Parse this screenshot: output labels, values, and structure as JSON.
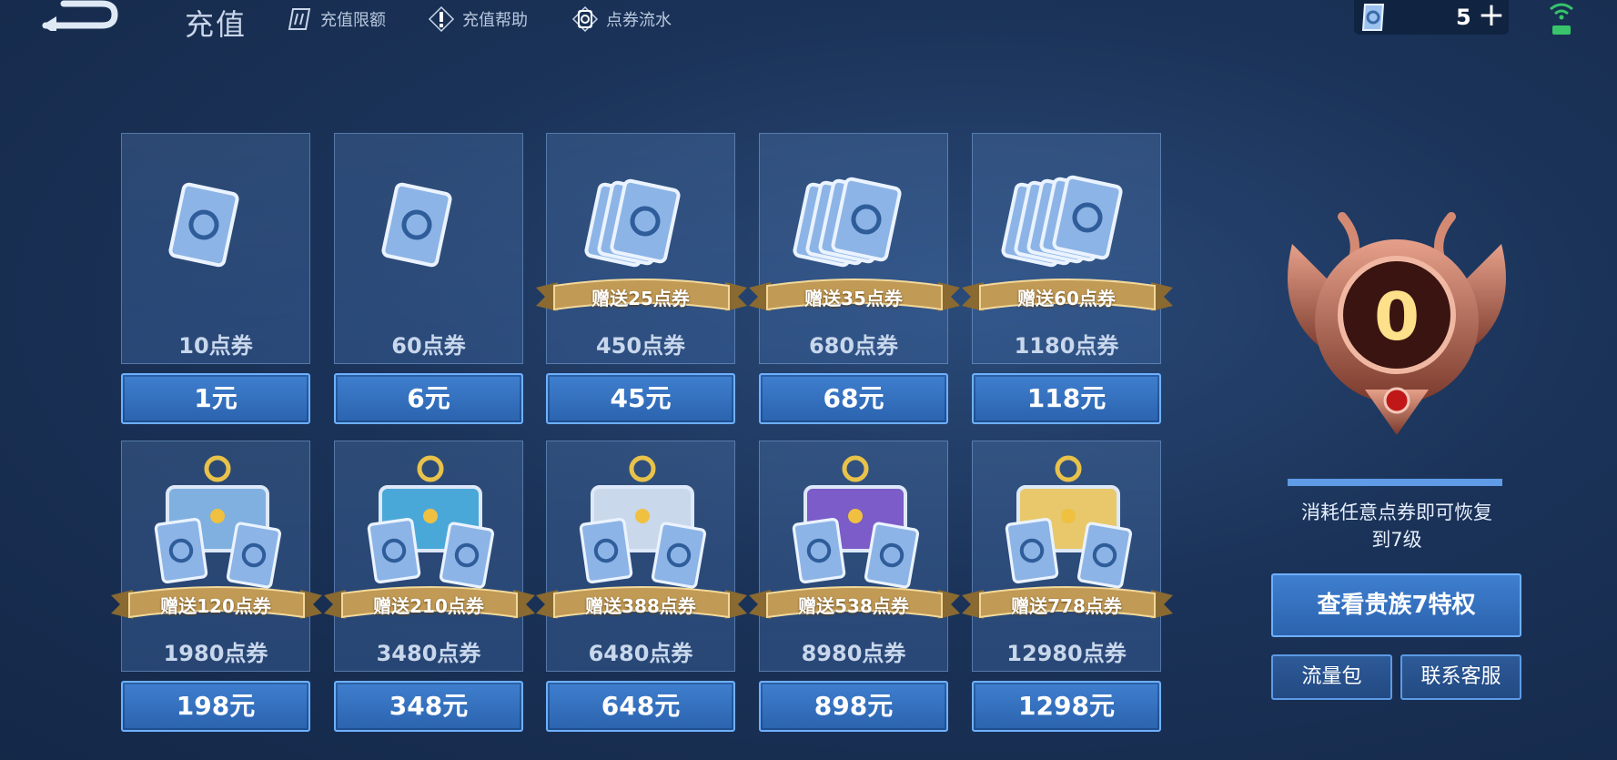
{
  "header": {
    "title": "充值",
    "links": [
      {
        "label": "充值限额",
        "icon": "cards-icon"
      },
      {
        "label": "充值帮助",
        "icon": "exclamation-icon"
      },
      {
        "label": "点券流水",
        "icon": "coupon-flow-icon"
      }
    ],
    "currency": {
      "value": "5",
      "icon": "coupon-icon",
      "add_icon": "plus-icon"
    }
  },
  "packages": [
    {
      "amount": "10点券",
      "price": "1元",
      "bonus": ""
    },
    {
      "amount": "60点券",
      "price": "6元",
      "bonus": ""
    },
    {
      "amount": "450点券",
      "price": "45元",
      "bonus": "赠送25点券"
    },
    {
      "amount": "680点券",
      "price": "68元",
      "bonus": "赠送35点券"
    },
    {
      "amount": "1180点券",
      "price": "118元",
      "bonus": "赠送60点券"
    },
    {
      "amount": "1980点券",
      "price": "198元",
      "bonus": "赠送120点券"
    },
    {
      "amount": "3480点券",
      "price": "348元",
      "bonus": "赠送210点券"
    },
    {
      "amount": "6480点券",
      "price": "648元",
      "bonus": "赠送388点券"
    },
    {
      "amount": "8980点券",
      "price": "898元",
      "bonus": "赠送538点券"
    },
    {
      "amount": "12980点券",
      "price": "1298元",
      "bonus": "赠送778点券"
    }
  ],
  "noble": {
    "level": "0",
    "restore_line1": "消耗任意点券即可恢复",
    "restore_line2": "到7级",
    "view_button": "查看贵族7特权",
    "traffic_button": "流量包",
    "support_button": "联系客服"
  },
  "colors": {
    "accent_blue": "#3f7fcf",
    "ribbon_gold": "#b8924a",
    "badge_bronze": "#a85a48"
  }
}
